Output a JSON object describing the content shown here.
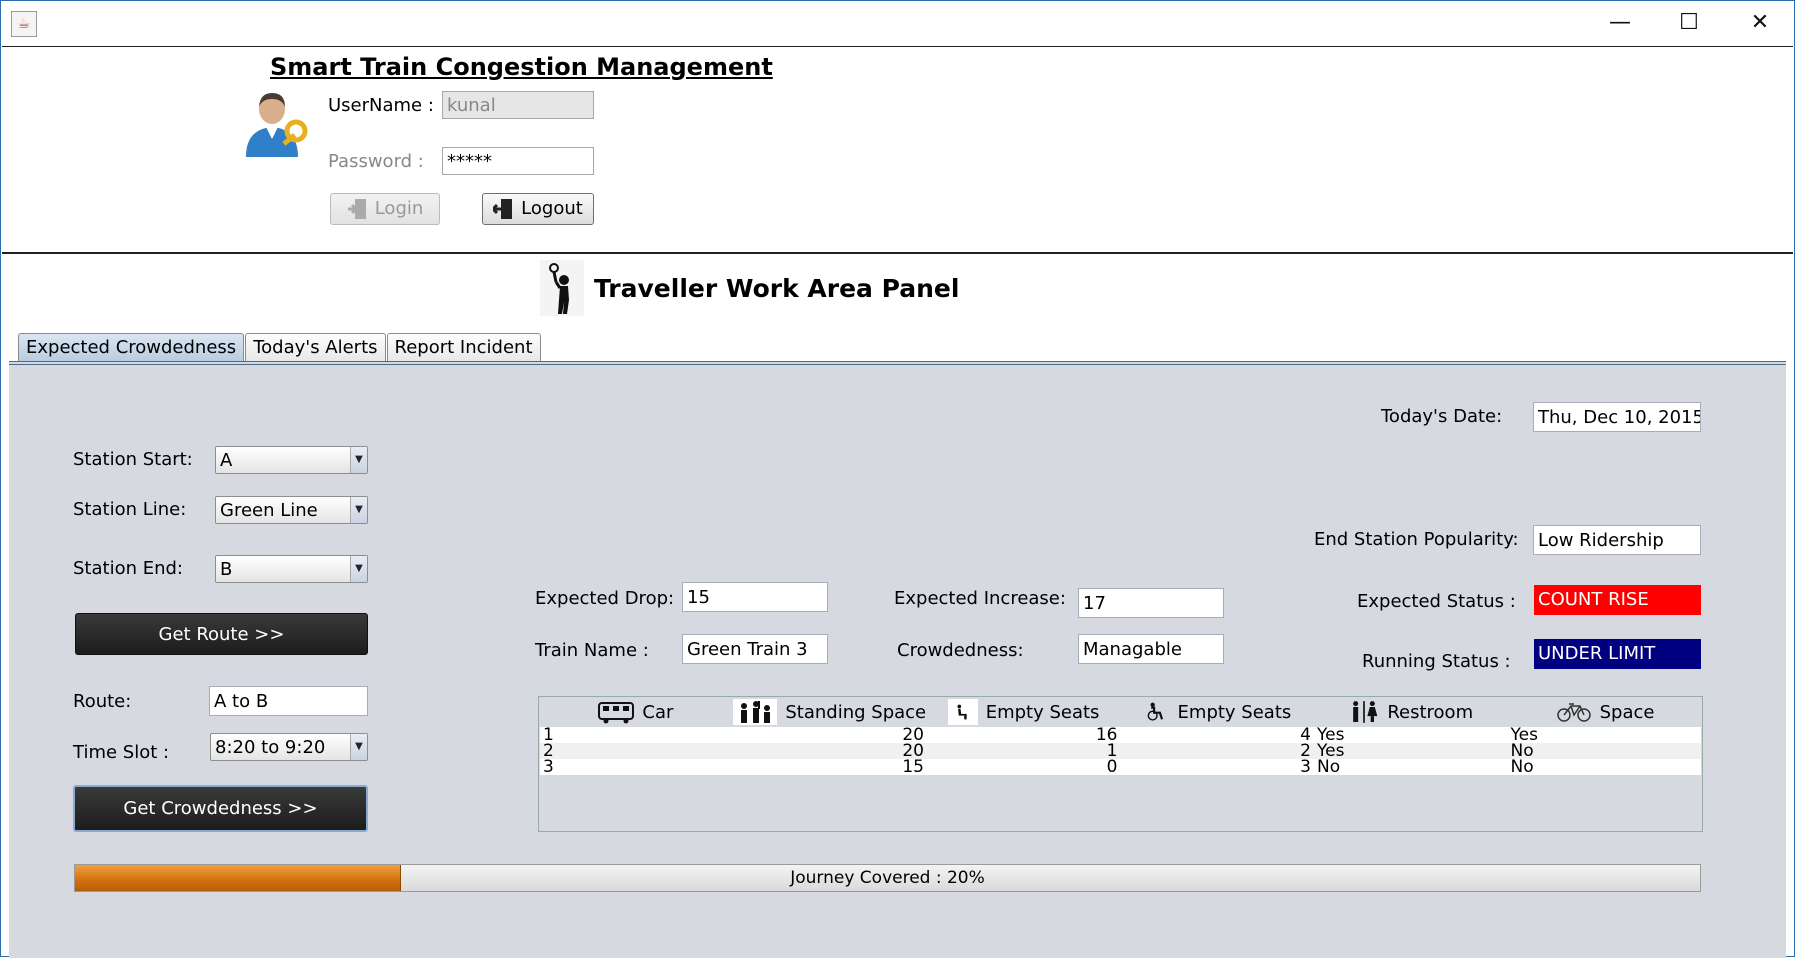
{
  "window": {
    "minimize_glyph": "—",
    "maximize_glyph": "☐",
    "close_glyph": "✕"
  },
  "login": {
    "title": "Smart Train Congestion Management",
    "username_label": "UserName :",
    "username_value": "kunal",
    "password_label": "Password :",
    "password_value": "*****",
    "login_button": "Login",
    "logout_button": "Logout"
  },
  "panel": {
    "title": "Traveller Work Area Panel"
  },
  "tabs": [
    {
      "label": "Expected Crowdedness",
      "active": true
    },
    {
      "label": "Today's Alerts",
      "active": false
    },
    {
      "label": "Report Incident",
      "active": false
    }
  ],
  "form": {
    "station_start_label": "Station Start:",
    "station_start_value": "A",
    "station_line_label": "Station Line:",
    "station_line_value": "Green Line",
    "station_end_label": "Station End:",
    "station_end_value": "B",
    "get_route_button": "Get Route >>",
    "route_label": "Route:",
    "route_value": "A to B",
    "time_slot_label": "Time Slot :",
    "time_slot_value": "8:20 to 9:20",
    "get_crowdedness_button": "Get Crowdedness >>",
    "combo_arrow": "▼"
  },
  "info": {
    "todays_date_label": "Today's Date:",
    "todays_date_value": "Thu, Dec 10, 2015",
    "end_station_popularity_label": "End Station Popularity:",
    "end_station_popularity_value": "Low Ridership",
    "expected_status_label": "Expected Status :",
    "expected_status_value": "COUNT RISE",
    "expected_status_color": "#ff0000",
    "running_status_label": "Running Status :",
    "running_status_value": "UNDER LIMIT",
    "running_status_color": "#000080",
    "expected_drop_label": "Expected Drop:",
    "expected_drop_value": "15",
    "expected_increase_label": "Expected Increase:",
    "expected_increase_value": "17",
    "train_name_label": "Train Name :",
    "train_name_value": "Green Train 3",
    "crowdedness_label": "Crowdedness:",
    "crowdedness_value": "Managable"
  },
  "table": {
    "columns": [
      {
        "label": "Car",
        "icon": "train-car-icon"
      },
      {
        "label": "Standing Space",
        "icon": "standing-passengers-icon"
      },
      {
        "label": "Empty Seats",
        "icon": "seated-person-icon"
      },
      {
        "label": "Empty Seats",
        "icon": "wheelchair-icon"
      },
      {
        "label": "Restroom",
        "icon": "restroom-icon"
      },
      {
        "label": "Space",
        "icon": "bicycle-icon"
      }
    ],
    "rows": [
      [
        "1",
        "20",
        "16",
        "4",
        "Yes",
        "Yes"
      ],
      [
        "2",
        "20",
        "1",
        "2",
        "Yes",
        "No"
      ],
      [
        "3",
        "15",
        "0",
        "3",
        "No",
        "No"
      ]
    ]
  },
  "progress": {
    "label": "Journey Covered : 20%",
    "percent": 20
  }
}
